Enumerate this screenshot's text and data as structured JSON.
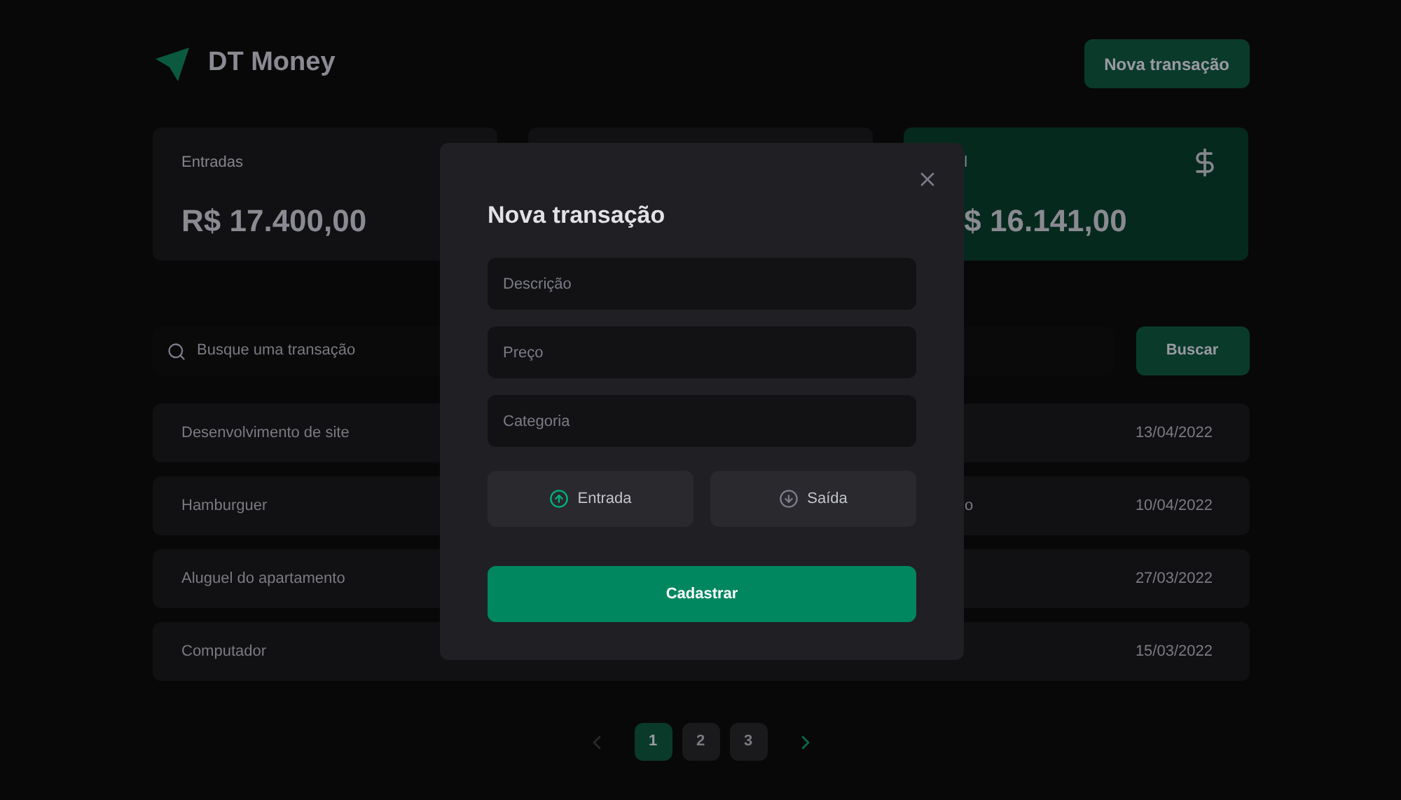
{
  "header": {
    "brand": "DT Money",
    "new_button": "Nova transação"
  },
  "summary": [
    {
      "kind": "income",
      "label": "Entradas",
      "value": "R$ 17.400,00"
    },
    {
      "kind": "outcome"
    },
    {
      "kind": "total",
      "label": "l",
      "value": "$ 16.141,00"
    }
  ],
  "search": {
    "placeholder": "Busque uma transação",
    "button": "Buscar"
  },
  "rows": [
    {
      "description": "Desenvolvimento de site",
      "date": "13/04/2022"
    },
    {
      "description": "Hamburguer",
      "column_2": "o",
      "date": "10/04/2022"
    },
    {
      "description": "Aluguel do apartamento",
      "date": "27/03/2022"
    },
    {
      "description": "Computador",
      "date": "15/03/2022"
    }
  ],
  "pagination": {
    "prev_disabled": true,
    "next_disabled": false,
    "pages": [
      {
        "label": "1",
        "selected": true
      },
      {
        "label": "2",
        "selected": false
      },
      {
        "label": "3",
        "selected": false
      }
    ]
  },
  "modal": {
    "title": "Nova transação",
    "fields": [
      {
        "placeholder": "Descrição"
      },
      {
        "placeholder": "Preço"
      },
      {
        "placeholder": "Categoria"
      }
    ],
    "types": [
      {
        "kind": "income",
        "label": "Entrada"
      },
      {
        "kind": "outcome",
        "label": "Saída"
      }
    ],
    "submit": "Cadastrar"
  }
}
